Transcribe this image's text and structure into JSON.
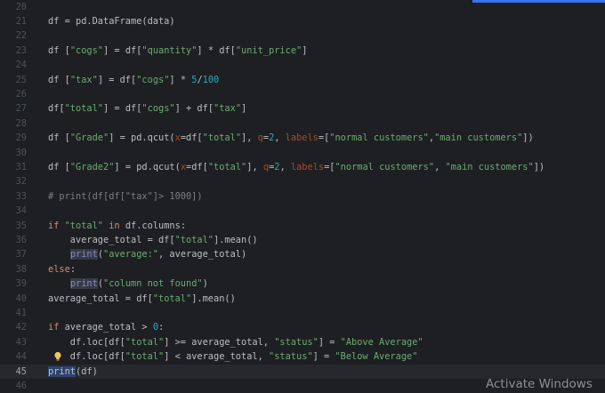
{
  "editor": {
    "lines": [
      {
        "n": "20",
        "tokens": []
      },
      {
        "n": "21",
        "tokens": [
          {
            "t": "df = pd.DataFrame(data)"
          }
        ]
      },
      {
        "n": "22",
        "tokens": []
      },
      {
        "n": "23",
        "tokens": [
          {
            "t": "df ["
          },
          {
            "t": "\"cogs\"",
            "c": "str"
          },
          {
            "t": "] = df["
          },
          {
            "t": "\"quantity\"",
            "c": "str"
          },
          {
            "t": "] * df["
          },
          {
            "t": "\"unit_price\"",
            "c": "str"
          },
          {
            "t": "]"
          }
        ]
      },
      {
        "n": "24",
        "tokens": []
      },
      {
        "n": "25",
        "tokens": [
          {
            "t": "df ["
          },
          {
            "t": "\"tax\"",
            "c": "str"
          },
          {
            "t": "] = df["
          },
          {
            "t": "\"cogs\"",
            "c": "str"
          },
          {
            "t": "] * "
          },
          {
            "t": "5",
            "c": "num"
          },
          {
            "t": "/"
          },
          {
            "t": "100",
            "c": "num"
          }
        ]
      },
      {
        "n": "26",
        "tokens": []
      },
      {
        "n": "27",
        "tokens": [
          {
            "t": "df["
          },
          {
            "t": "\"total\"",
            "c": "str"
          },
          {
            "t": "] = df["
          },
          {
            "t": "\"cogs\"",
            "c": "str"
          },
          {
            "t": "] + df["
          },
          {
            "t": "\"tax\"",
            "c": "str"
          },
          {
            "t": "]"
          }
        ]
      },
      {
        "n": "28",
        "tokens": []
      },
      {
        "n": "29",
        "tokens": [
          {
            "t": "df ["
          },
          {
            "t": "\"Grade\"",
            "c": "str"
          },
          {
            "t": "] = pd.qcut("
          },
          {
            "t": "x",
            "c": "kwarg"
          },
          {
            "t": "=df["
          },
          {
            "t": "\"total\"",
            "c": "str"
          },
          {
            "t": "], "
          },
          {
            "t": "q",
            "c": "kwarg"
          },
          {
            "t": "="
          },
          {
            "t": "2",
            "c": "num"
          },
          {
            "t": ", "
          },
          {
            "t": "labels",
            "c": "kwarg"
          },
          {
            "t": "=["
          },
          {
            "t": "\"normal customers\"",
            "c": "str"
          },
          {
            "t": ","
          },
          {
            "t": "\"main customers\"",
            "c": "str"
          },
          {
            "t": "])"
          }
        ]
      },
      {
        "n": "30",
        "tokens": []
      },
      {
        "n": "31",
        "tokens": [
          {
            "t": "df ["
          },
          {
            "t": "\"Grade2\"",
            "c": "str"
          },
          {
            "t": "] = pd.qcut("
          },
          {
            "t": "x",
            "c": "kwarg"
          },
          {
            "t": "=df["
          },
          {
            "t": "\"total\"",
            "c": "str"
          },
          {
            "t": "], "
          },
          {
            "t": "q",
            "c": "kwarg"
          },
          {
            "t": "="
          },
          {
            "t": "2",
            "c": "num"
          },
          {
            "t": ", "
          },
          {
            "t": "labels",
            "c": "kwarg"
          },
          {
            "t": "=["
          },
          {
            "t": "\"normal customers\"",
            "c": "str"
          },
          {
            "t": ", "
          },
          {
            "t": "\"main customers\"",
            "c": "str"
          },
          {
            "t": "])"
          }
        ]
      },
      {
        "n": "32",
        "tokens": []
      },
      {
        "n": "33",
        "tokens": [
          {
            "t": "# print(df[df[\"tax\"]> 1000])",
            "c": "cmt"
          }
        ]
      },
      {
        "n": "34",
        "tokens": []
      },
      {
        "n": "35",
        "tokens": [
          {
            "t": "if ",
            "c": "kw"
          },
          {
            "t": "\"total\"",
            "c": "str"
          },
          {
            "t": " in ",
            "c": "kw"
          },
          {
            "t": "df.columns:"
          }
        ]
      },
      {
        "n": "36",
        "tokens": [
          {
            "t": "    average_total = df["
          },
          {
            "t": "\"total\"",
            "c": "str"
          },
          {
            "t": "].mean()"
          }
        ]
      },
      {
        "n": "37",
        "tokens": [
          {
            "t": "    "
          },
          {
            "t": "print",
            "c": "fn"
          },
          {
            "t": "("
          },
          {
            "t": "\"average:\"",
            "c": "str"
          },
          {
            "t": ", average_total)"
          }
        ]
      },
      {
        "n": "38",
        "tokens": [
          {
            "t": "else",
            "c": "kw"
          },
          {
            "t": ":"
          }
        ]
      },
      {
        "n": "39",
        "tokens": [
          {
            "t": "    "
          },
          {
            "t": "print",
            "c": "fn"
          },
          {
            "t": "("
          },
          {
            "t": "\"column not found\"",
            "c": "str"
          },
          {
            "t": ")"
          }
        ]
      },
      {
        "n": "40",
        "tokens": [
          {
            "t": "average_total = df["
          },
          {
            "t": "\"total\"",
            "c": "str"
          },
          {
            "t": "].mean()"
          }
        ]
      },
      {
        "n": "41",
        "tokens": []
      },
      {
        "n": "42",
        "tokens": [
          {
            "t": "if ",
            "c": "kw"
          },
          {
            "t": "average_total > "
          },
          {
            "t": "0",
            "c": "num"
          },
          {
            "t": ":"
          }
        ]
      },
      {
        "n": "43",
        "tokens": [
          {
            "t": "    df.loc[df["
          },
          {
            "t": "\"total\"",
            "c": "str"
          },
          {
            "t": "] >= average_total, "
          },
          {
            "t": "\"status\"",
            "c": "str"
          },
          {
            "t": "] = "
          },
          {
            "t": "\"Above Average\"",
            "c": "str"
          }
        ]
      },
      {
        "n": "44",
        "tokens": [
          {
            "t": "    df.loc[df["
          },
          {
            "t": "\"total\"",
            "c": "str"
          },
          {
            "t": "] < average_total, "
          },
          {
            "t": "\"status\"",
            "c": "str"
          },
          {
            "t": "] = "
          },
          {
            "t": "\"Below Average\"",
            "c": "str"
          }
        ],
        "bulb": true
      },
      {
        "n": "45",
        "tokens": [
          {
            "t": "print",
            "c": "sel"
          },
          {
            "t": "(df)"
          }
        ],
        "current": true
      },
      {
        "n": "46",
        "tokens": []
      }
    ]
  },
  "watermark": {
    "text": "Activate Windows"
  },
  "colors": {
    "background": "#1e1f22",
    "keyword": "#cf8e6d",
    "string": "#6aab73",
    "number": "#2aacb8",
    "kwarg": "#aa4926",
    "comment": "#7a7e85",
    "accent": "#3574f0"
  },
  "icons": {
    "intention": "lightbulb-icon"
  }
}
